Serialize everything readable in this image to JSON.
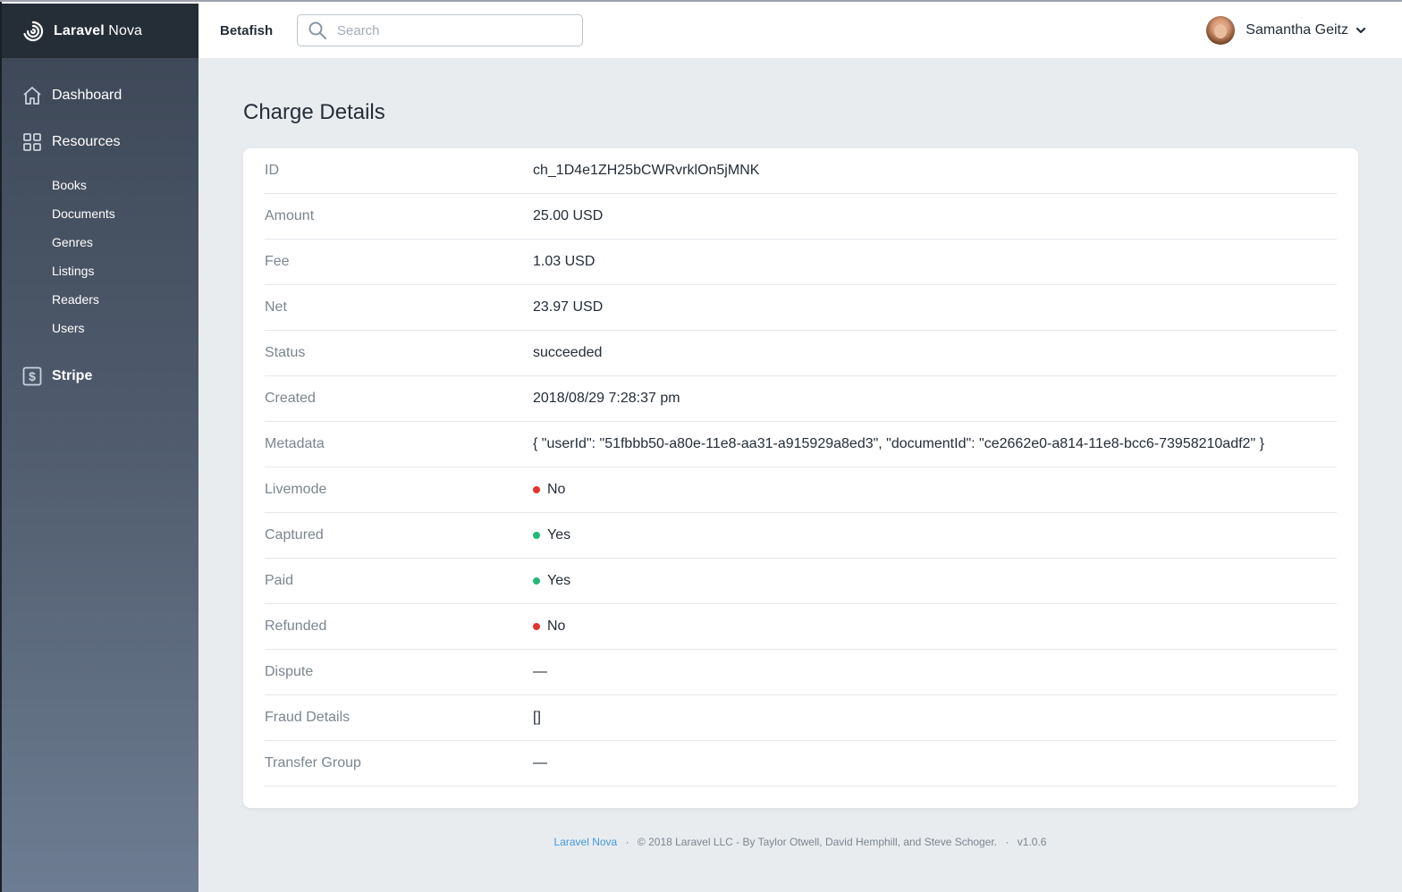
{
  "brand": {
    "bold": "Laravel",
    "rest": " Nova"
  },
  "sidebar": {
    "dashboard_label": "Dashboard",
    "resources_label": "Resources",
    "resources": [
      "Books",
      "Documents",
      "Genres",
      "Listings",
      "Readers",
      "Users"
    ],
    "stripe_label": "Stripe"
  },
  "header": {
    "app_name": "Betafish",
    "search_placeholder": "Search",
    "user_name": "Samantha Geitz"
  },
  "page": {
    "title": "Charge Details"
  },
  "details": [
    {
      "label": "ID",
      "value": "ch_1D4e1ZH25bCWRvrklOn5jMNK"
    },
    {
      "label": "Amount",
      "value": "25.00 USD"
    },
    {
      "label": "Fee",
      "value": "1.03 USD"
    },
    {
      "label": "Net",
      "value": "23.97 USD"
    },
    {
      "label": "Status",
      "value": "succeeded"
    },
    {
      "label": "Created",
      "value": "2018/08/29 7:28:37 pm"
    },
    {
      "label": "Metadata",
      "value": "{ \"userId\": \"51fbbb50-a80e-11e8-aa31-a915929a8ed3\", \"documentId\": \"ce2662e0-a814-11e8-bcc6-73958210adf2\" }"
    },
    {
      "label": "Livemode",
      "value": "No",
      "status_color": "#e3342f"
    },
    {
      "label": "Captured",
      "value": "Yes",
      "status_color": "#21b978"
    },
    {
      "label": "Paid",
      "value": "Yes",
      "status_color": "#21b978"
    },
    {
      "label": "Refunded",
      "value": "No",
      "status_color": "#e3342f"
    },
    {
      "label": "Dispute",
      "value": "—"
    },
    {
      "label": "Fraud Details",
      "value": "[]"
    },
    {
      "label": "Transfer Group",
      "value": "—"
    }
  ],
  "footer": {
    "link": "Laravel Nova",
    "copyright": "© 2018 Laravel LLC - By Taylor Otwell, David Hemphill, and Steve Schoger.",
    "version": "v1.0.6"
  },
  "colors": {
    "sidebar_top": "#3c4655",
    "sidebar_bottom": "#6d7c92",
    "brand_bg": "#252d37",
    "accent_link": "#4099de",
    "status_yes": "#21b978",
    "status_no": "#e3342f"
  }
}
